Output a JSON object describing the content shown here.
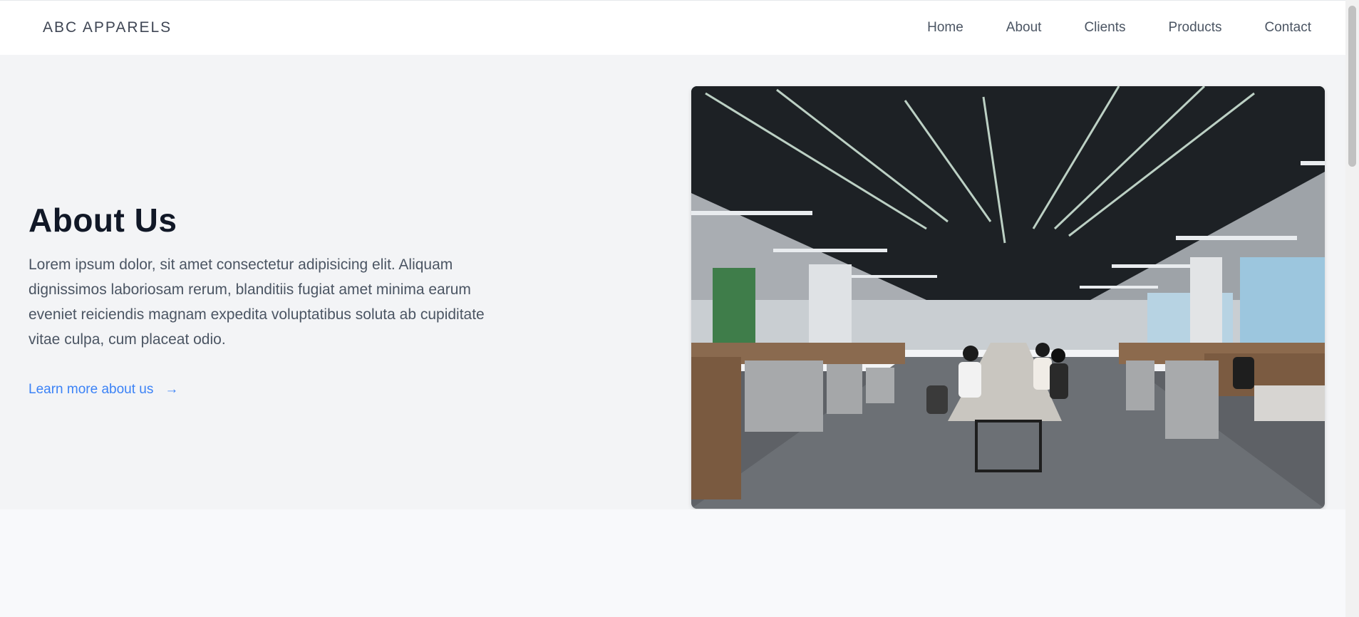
{
  "brand": {
    "name": "ABC APPARELS"
  },
  "nav": {
    "items": [
      {
        "label": "Home"
      },
      {
        "label": "About"
      },
      {
        "label": "Clients"
      },
      {
        "label": "Products"
      },
      {
        "label": "Contact"
      }
    ]
  },
  "hero": {
    "title": "About Us",
    "body": "Lorem ipsum dolor, sit amet consectetur adipisicing elit. Aliquam dignissimos laboriosam rerum, blanditiis fugiat amet minima earum eveniet reiciendis magnam expedita voluptatibus soluta ab cupiditate vitae culpa, cum placeat odio.",
    "link_label": "Learn more about us",
    "link_arrow": "→",
    "image_icon": "office-photo"
  },
  "colors": {
    "nav_bg": "#ffffff",
    "hero_bg": "#f3f4f6",
    "title": "#111827",
    "body_text": "#4b5563",
    "link": "#3b82f6"
  }
}
